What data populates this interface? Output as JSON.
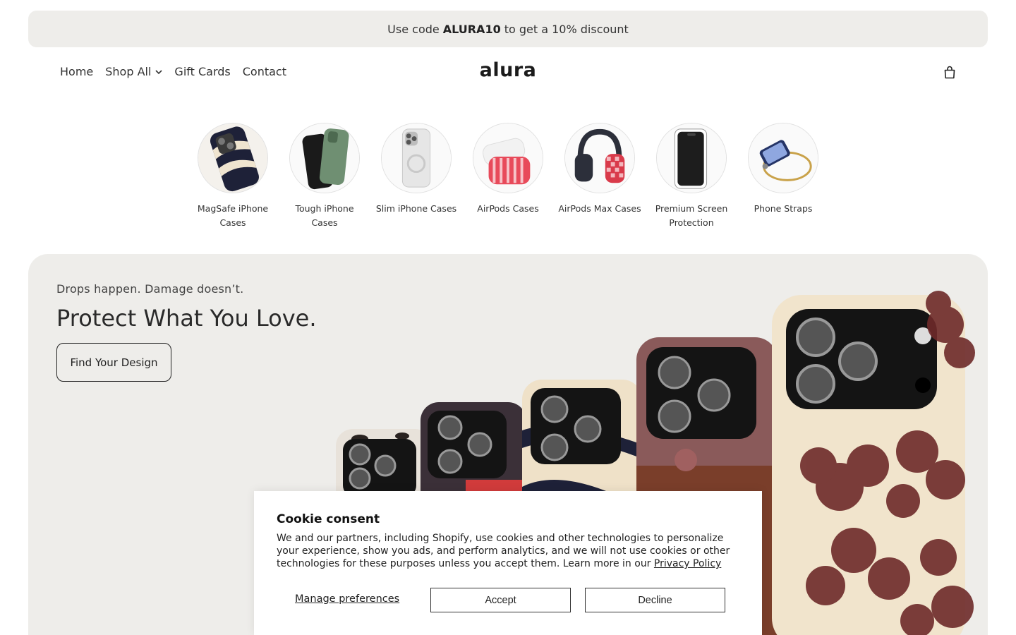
{
  "announcement": {
    "prefix": "Use code",
    "code": "ALURA10",
    "suffix": "to get a 10% discount"
  },
  "nav": {
    "items": [
      {
        "label": "Home"
      },
      {
        "label": "Shop All"
      },
      {
        "label": "Gift Cards"
      },
      {
        "label": "Contact"
      }
    ],
    "logo": "alura"
  },
  "categories": [
    {
      "label": "MagSafe iPhone Cases"
    },
    {
      "label": "Tough iPhone Cases"
    },
    {
      "label": "Slim iPhone Cases"
    },
    {
      "label": "AirPods Cases"
    },
    {
      "label": "AirPods Max Cases"
    },
    {
      "label": "Premium Screen Protection"
    },
    {
      "label": "Phone Straps"
    }
  ],
  "hero": {
    "subtitle": "Drops happen. Damage doesn’t.",
    "title": "Protect What You Love.",
    "button": "Find Your Design"
  },
  "cookie": {
    "title": "Cookie consent",
    "body": "We and our partners, including Shopify, use cookies and other technologies to personalize your experience, show you ads, and perform analytics, and we will not use cookies or other technologies for these purposes unless you accept them. Learn more in our",
    "policy_link": "Privacy Policy",
    "manage": "Manage preferences",
    "accept": "Accept",
    "decline": "Decline"
  },
  "colors": {
    "panel_bg": "#eeedea",
    "accent_dark": "#1b1b1b",
    "flower": "#6e2a2a"
  }
}
